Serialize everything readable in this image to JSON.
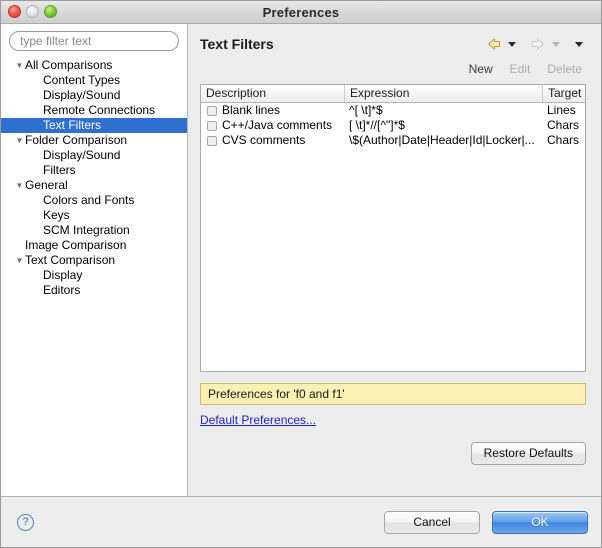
{
  "window": {
    "title": "Preferences",
    "traffic_lights": [
      "close",
      "minimize",
      "zoom"
    ]
  },
  "sidebar": {
    "filter": {
      "placeholder": "type filter text",
      "value": ""
    },
    "items": [
      {
        "label": "All Comparisons",
        "level": 0,
        "expandable": true,
        "selected": false
      },
      {
        "label": "Content Types",
        "level": 1,
        "expandable": false,
        "selected": false
      },
      {
        "label": "Display/Sound",
        "level": 1,
        "expandable": false,
        "selected": false
      },
      {
        "label": "Remote Connections",
        "level": 1,
        "expandable": false,
        "selected": false
      },
      {
        "label": "Text Filters",
        "level": 1,
        "expandable": false,
        "selected": true
      },
      {
        "label": "Folder Comparison",
        "level": 0,
        "expandable": true,
        "selected": false
      },
      {
        "label": "Display/Sound",
        "level": 1,
        "expandable": false,
        "selected": false
      },
      {
        "label": "Filters",
        "level": 1,
        "expandable": false,
        "selected": false
      },
      {
        "label": "General",
        "level": 0,
        "expandable": true,
        "selected": false
      },
      {
        "label": "Colors and Fonts",
        "level": 1,
        "expandable": false,
        "selected": false
      },
      {
        "label": "Keys",
        "level": 1,
        "expandable": false,
        "selected": false
      },
      {
        "label": "SCM Integration",
        "level": 1,
        "expandable": false,
        "selected": false
      },
      {
        "label": "Image Comparison",
        "level": 0,
        "expandable": false,
        "selected": false
      },
      {
        "label": "Text Comparison",
        "level": 0,
        "expandable": true,
        "selected": false
      },
      {
        "label": "Display",
        "level": 1,
        "expandable": false,
        "selected": false
      },
      {
        "label": "Editors",
        "level": 1,
        "expandable": false,
        "selected": false
      }
    ],
    "twisty_glyph": "▼",
    "selection_color": "#2f6fd0"
  },
  "main": {
    "page_title": "Text Filters",
    "nav": {
      "back_icon": "back-arrow-icon",
      "back_enabled": true,
      "forward_icon": "forward-arrow-icon",
      "forward_enabled": false,
      "menu_icon": "chevron-down-icon"
    },
    "actions": {
      "new_label": "New",
      "new_enabled": true,
      "edit_label": "Edit",
      "edit_enabled": false,
      "delete_label": "Delete",
      "delete_enabled": false
    },
    "table": {
      "columns": [
        "Description",
        "Expression",
        "Target"
      ],
      "rows": [
        {
          "checked": false,
          "description": "Blank lines",
          "expression": "^[ \\t]*$",
          "target": "Lines"
        },
        {
          "checked": false,
          "description": "C++/Java comments",
          "expression": "[ \\t]*//[^\"]*$",
          "target": "Chars"
        },
        {
          "checked": false,
          "description": "CVS comments",
          "expression": "\\$(Author|Date|Header|Id|Locker|...",
          "target": "Chars"
        }
      ]
    },
    "info_message": "Preferences for 'f0 and f1'",
    "info_background": "#faf0b4",
    "default_preferences_link": "Default Preferences...",
    "restore_defaults_label": "Restore Defaults"
  },
  "footer": {
    "help_icon": "help-icon",
    "help_glyph": "?",
    "cancel_label": "Cancel",
    "ok_label": "OK",
    "default_button": "OK"
  }
}
